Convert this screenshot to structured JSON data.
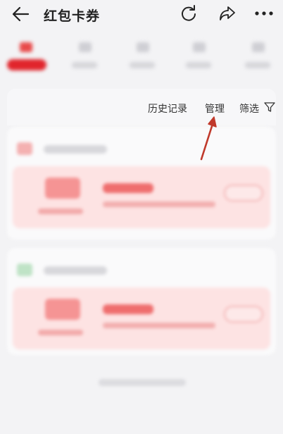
{
  "header": {
    "title": "红包卡券",
    "back_icon": "back-arrow-icon",
    "refresh_icon": "refresh-icon",
    "share_icon": "share-icon",
    "more_icon": "more-icon"
  },
  "toolbar": {
    "history_label": "历史记录",
    "manage_label": "管理",
    "filter_label": "筛选",
    "filter_icon": "filter-icon"
  },
  "colors": {
    "accent": "#e1252c",
    "coupon_bg": "#fde3e3",
    "annotation_arrow": "#c0392b"
  }
}
